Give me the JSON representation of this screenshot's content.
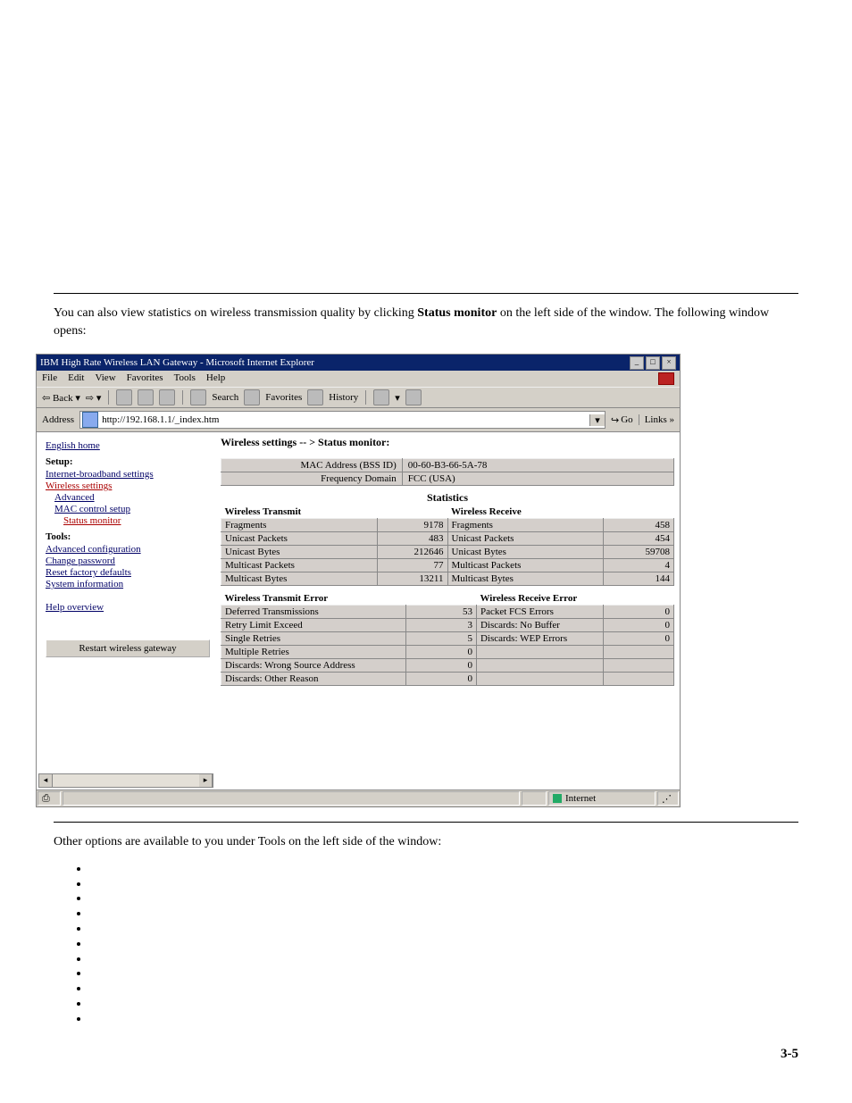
{
  "doc": {
    "para_pre": "You can also view statistics on wireless transmission quality by clicking ",
    "bold1": "Status monitor",
    "para_post": " on the left side of the window. The following window opens:",
    "tools_intro": "Other options are available to you under Tools on the left side of the window:",
    "bullets": [
      "",
      "",
      "",
      "",
      "",
      "",
      "",
      "",
      "",
      "",
      ""
    ],
    "page_number": "3-5"
  },
  "ie": {
    "title": "IBM High Rate Wireless LAN Gateway - Microsoft Internet Explorer",
    "menus": [
      "File",
      "Edit",
      "View",
      "Favorites",
      "Tools",
      "Help"
    ],
    "toolbar": {
      "back": "Back",
      "sep": "•",
      "search": "Search",
      "favorites": "Favorites",
      "history": "History"
    },
    "address": {
      "label": "Address",
      "value": "http://192.168.1.1/_index.htm",
      "go": "Go",
      "links": "Links »"
    },
    "statusbar": {
      "zone": "Internet"
    }
  },
  "side": {
    "english": "English home",
    "setup": "Setup:",
    "internet": "Internet-broadband settings",
    "wireless": "Wireless settings",
    "advanced": "Advanced",
    "mac": "MAC control setup",
    "status": "Status monitor",
    "tools": "Tools:",
    "advconf": "Advanced configuration",
    "chpass": "Change password",
    "reset": "Reset factory defaults",
    "sysinfo": "System information",
    "help": "Help overview",
    "restart": "Restart wireless gateway"
  },
  "content": {
    "breadcrumb": "Wireless settings -- > Status monitor:",
    "mac_addr_label": "MAC Address (BSS ID)",
    "mac_addr": "00-60-B3-66-5A-78",
    "freq_label": "Frequency Domain",
    "freq": "FCC (USA)",
    "stats_header": "Statistics",
    "tx_header": "Wireless Transmit",
    "rx_header": "Wireless Receive",
    "tx": [
      {
        "l": "Fragments",
        "v": "9178"
      },
      {
        "l": "Unicast Packets",
        "v": "483"
      },
      {
        "l": "Unicast Bytes",
        "v": "212646"
      },
      {
        "l": "Multicast Packets",
        "v": "77"
      },
      {
        "l": "Multicast Bytes",
        "v": "13211"
      }
    ],
    "rx": [
      {
        "l": "Fragments",
        "v": "458"
      },
      {
        "l": "Unicast Packets",
        "v": "454"
      },
      {
        "l": "Unicast Bytes",
        "v": "59708"
      },
      {
        "l": "Multicast Packets",
        "v": "4"
      },
      {
        "l": "Multicast Bytes",
        "v": "144"
      }
    ],
    "txe_header": "Wireless Transmit Error",
    "rxe_header": "Wireless Receive Error",
    "txe": [
      {
        "l": "Deferred Transmissions",
        "v": "53"
      },
      {
        "l": "Retry Limit Exceed",
        "v": "3"
      },
      {
        "l": "Single Retries",
        "v": "5"
      },
      {
        "l": "Multiple Retries",
        "v": "0"
      },
      {
        "l": "Discards: Wrong Source Address",
        "v": "0"
      },
      {
        "l": "Discards: Other Reason",
        "v": "0"
      }
    ],
    "rxe": [
      {
        "l": "Packet FCS Errors",
        "v": "0"
      },
      {
        "l": "Discards: No Buffer",
        "v": "0"
      },
      {
        "l": "Discards: WEP Errors",
        "v": "0"
      }
    ]
  }
}
